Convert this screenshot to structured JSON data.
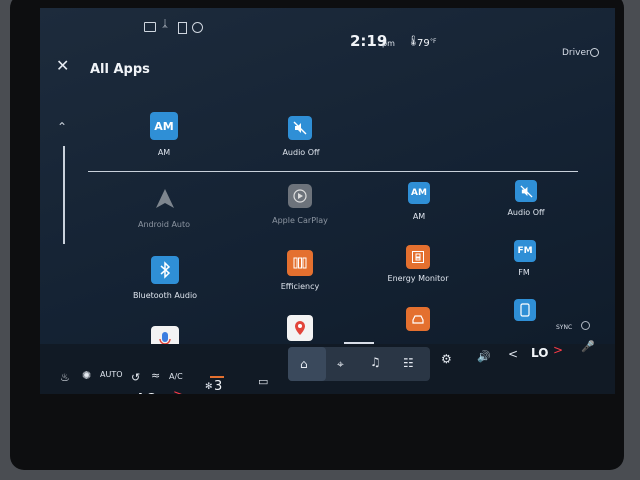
{
  "status": {
    "time": "2:19",
    "ampm": "pm",
    "temp": "79",
    "temp_unit": "°F",
    "profile": "Driver"
  },
  "header": {
    "title": "All Apps"
  },
  "favorites": [
    {
      "label": "AM",
      "tile": "AM"
    },
    {
      "label": "Audio Off",
      "tile": ""
    }
  ],
  "apps": [
    {
      "label": "Android Auto",
      "dim": true
    },
    {
      "label": "Apple CarPlay",
      "dim": true
    },
    {
      "label": "AM",
      "tile": "AM"
    },
    {
      "label": "Audio Off"
    },
    {
      "label": "Bluetooth Audio"
    },
    {
      "label": "Efficiency"
    },
    {
      "label": "Energy Monitor"
    },
    {
      "label": "FM",
      "tile": "FM"
    }
  ],
  "climate": {
    "mode": "AUTO",
    "ac": "A/C",
    "left_temp": "LO",
    "right_temp": "LO",
    "fan_level": "3",
    "sync": "SYNC"
  },
  "colors": {
    "accent_blue": "#2f8fd6",
    "accent_orange": "#e4702f",
    "alert_red": "#ff3b47"
  }
}
